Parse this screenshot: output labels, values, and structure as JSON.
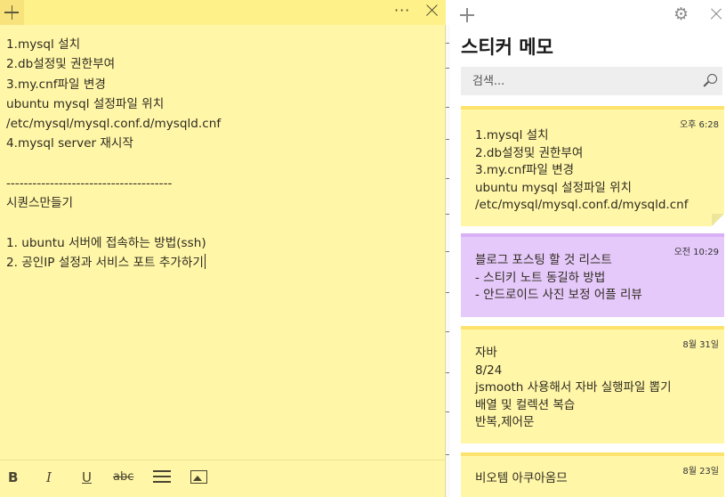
{
  "editor": {
    "lines": [
      "1.mysql 설치",
      "2.db설정및 권한부여",
      "3.my.cnf파일 변경",
      "ubuntu mysql 설정파일 위치",
      "/etc/mysql/mysql.conf.d/mysqld.cnf",
      "4.mysql server 재시작",
      "",
      "--------------------------------------",
      "시퀀스만들기",
      "",
      "1. ubuntu 서버에 접속하는 방법(ssh)",
      "2. 공인IP 설정과 서비스 포트 추가하기"
    ],
    "more_label": "···",
    "toolbar": {
      "bold": "B",
      "italic": "I",
      "underline": "U",
      "strikethrough": "abc"
    }
  },
  "list": {
    "title": "스티커 메모",
    "gear_glyph": "⚙",
    "search": {
      "placeholder": "검색..."
    },
    "notes": [
      {
        "time": "오후 6:28",
        "color": "#fff6a8",
        "strip": "#fde36c",
        "lines": [
          "1.mysql 설치",
          "2.db설정및 권한부여",
          "3.my.cnf파일 변경",
          "ubuntu mysql 설정파일 위치",
          "/etc/mysql/mysql.conf.d/mysqld.cnf"
        ]
      },
      {
        "time": "오전 10:29",
        "color": "#e6c9fb",
        "strip": "#d9aff6",
        "lines": [
          "블로그 포스팅 할 것 리스트",
          "- 스티키 노트 동길하 방법",
          "- 안드로이드 사진 보정 어플 리뷰"
        ]
      },
      {
        "time": "8월 31일",
        "color": "#fff6a8",
        "strip": "#fde36c",
        "lines": [
          "자바",
          "8/24",
          "jsmooth 사용해서 자바 실행파일 뽑기",
          "배열 및 컬렉션 복습",
          "반복,제어문"
        ]
      },
      {
        "time": "8월 23일",
        "color": "#fff6a8",
        "strip": "#fde36c",
        "lines": [
          "비오템 아쿠아옴므"
        ]
      }
    ]
  }
}
